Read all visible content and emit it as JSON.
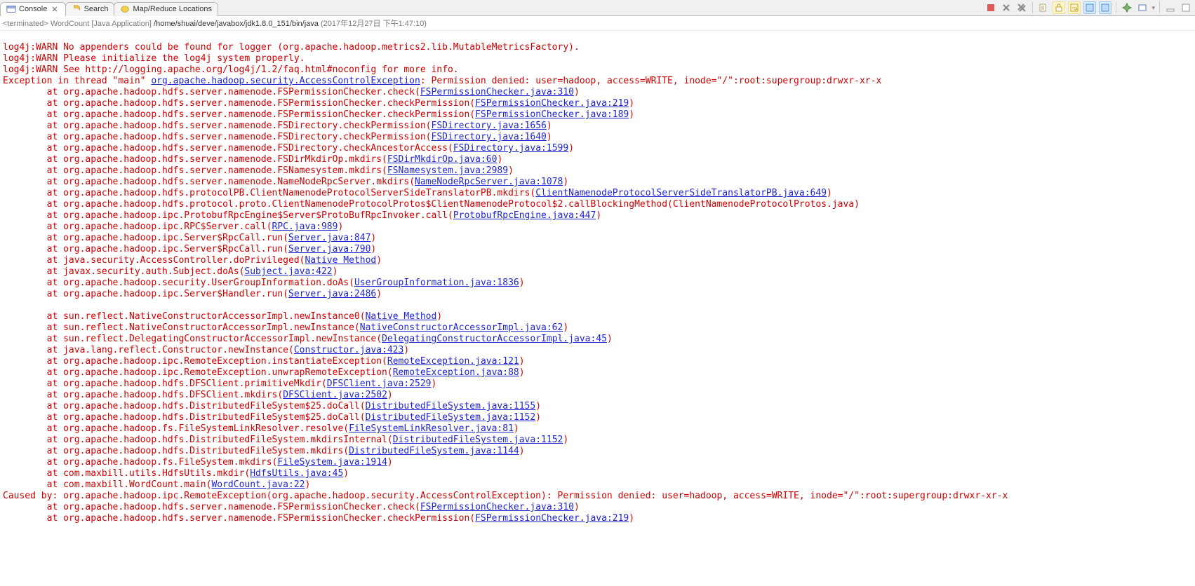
{
  "tabs": {
    "console": "Console",
    "search": "Search",
    "mapreduce": "Map/Reduce Locations"
  },
  "status": {
    "prefix": "<terminated> WordCount [Java Application] ",
    "path": "/home/shuai/deve/javabox/jdk1.8.0_151/bin/java",
    "time": " (2017年12月27日 下午1:47:10)"
  },
  "lines": {
    "l0": "log4j:WARN No appenders could be found for logger (org.apache.hadoop.metrics2.lib.MutableMetricsFactory).",
    "l1": "log4j:WARN Please initialize the log4j system properly.",
    "l2": "log4j:WARN See http://logging.apache.org/log4j/1.2/faq.html#noconfig for more info.",
    "e_pre": "Exception in thread \"main\" ",
    "e_link": "org.apache.hadoop.security.AccessControlException",
    "e_post": ": Permission denied: user=hadoop, access=WRITE, inode=\"/\":root:supergroup:drwxr-xr-x",
    "at": "\tat ",
    "s1a": "org.apache.hadoop.hdfs.server.namenode.FSPermissionChecker.check(",
    "s1b": "FSPermissionChecker.java:310",
    "s2a": "org.apache.hadoop.hdfs.server.namenode.FSPermissionChecker.checkPermission(",
    "s2b": "FSPermissionChecker.java:219",
    "s3a": "org.apache.hadoop.hdfs.server.namenode.FSPermissionChecker.checkPermission(",
    "s3b": "FSPermissionChecker.java:189",
    "s4a": "org.apache.hadoop.hdfs.server.namenode.FSDirectory.checkPermission(",
    "s4b": "FSDirectory.java:1656",
    "s5a": "org.apache.hadoop.hdfs.server.namenode.FSDirectory.checkPermission(",
    "s5b": "FSDirectory.java:1640",
    "s6a": "org.apache.hadoop.hdfs.server.namenode.FSDirectory.checkAncestorAccess(",
    "s6b": "FSDirectory.java:1599",
    "s7a": "org.apache.hadoop.hdfs.server.namenode.FSDirMkdirOp.mkdirs(",
    "s7b": "FSDirMkdirOp.java:60",
    "s8a": "org.apache.hadoop.hdfs.server.namenode.FSNamesystem.mkdirs(",
    "s8b": "FSNamesystem.java:2989",
    "s9a": "org.apache.hadoop.hdfs.server.namenode.NameNodeRpcServer.mkdirs(",
    "s9b": "NameNodeRpcServer.java:1078",
    "s10a": "org.apache.hadoop.hdfs.protocolPB.ClientNamenodeProtocolServerSideTranslatorPB.mkdirs(",
    "s10b": "ClientNamenodeProtocolServerSideTranslatorPB.java:649",
    "s11": "org.apache.hadoop.hdfs.protocol.proto.ClientNamenodeProtocolProtos$ClientNamenodeProtocol$2.callBlockingMethod(ClientNamenodeProtocolProtos.java)",
    "s12a": "org.apache.hadoop.ipc.ProtobufRpcEngine$Server$ProtoBufRpcInvoker.call(",
    "s12b": "ProtobufRpcEngine.java:447",
    "s13a": "org.apache.hadoop.ipc.RPC$Server.call(",
    "s13b": "RPC.java:989",
    "s14a": "org.apache.hadoop.ipc.Server$RpcCall.run(",
    "s14b": "Server.java:847",
    "s15a": "org.apache.hadoop.ipc.Server$RpcCall.run(",
    "s15b": "Server.java:790",
    "s16a": "java.security.AccessController.doPrivileged(",
    "s16b": "Native Method",
    "s17a": "javax.security.auth.Subject.doAs(",
    "s17b": "Subject.java:422",
    "s18a": "org.apache.hadoop.security.UserGroupInformation.doAs(",
    "s18b": "UserGroupInformation.java:1836",
    "s19a": "org.apache.hadoop.ipc.Server$Handler.run(",
    "s19b": "Server.java:2486",
    "s20a": "sun.reflect.NativeConstructorAccessorImpl.newInstance0(",
    "s20b": "Native Method",
    "s21a": "sun.reflect.NativeConstructorAccessorImpl.newInstance(",
    "s21b": "NativeConstructorAccessorImpl.java:62",
    "s22a": "sun.reflect.DelegatingConstructorAccessorImpl.newInstance(",
    "s22b": "DelegatingConstructorAccessorImpl.java:45",
    "s23a": "java.lang.reflect.Constructor.newInstance(",
    "s23b": "Constructor.java:423",
    "s24a": "org.apache.hadoop.ipc.RemoteException.instantiateException(",
    "s24b": "RemoteException.java:121",
    "s25a": "org.apache.hadoop.ipc.RemoteException.unwrapRemoteException(",
    "s25b": "RemoteException.java:88",
    "s26a": "org.apache.hadoop.hdfs.DFSClient.primitiveMkdir(",
    "s26b": "DFSClient.java:2529",
    "s27a": "org.apache.hadoop.hdfs.DFSClient.mkdirs(",
    "s27b": "DFSClient.java:2502",
    "s28a": "org.apache.hadoop.hdfs.DistributedFileSystem$25.doCall(",
    "s28b": "DistributedFileSystem.java:1155",
    "s29a": "org.apache.hadoop.hdfs.DistributedFileSystem$25.doCall(",
    "s29b": "DistributedFileSystem.java:1152",
    "s30a": "org.apache.hadoop.fs.FileSystemLinkResolver.resolve(",
    "s30b": "FileSystemLinkResolver.java:81",
    "s31a": "org.apache.hadoop.hdfs.DistributedFileSystem.mkdirsInternal(",
    "s31b": "DistributedFileSystem.java:1152",
    "s32a": "org.apache.hadoop.hdfs.DistributedFileSystem.mkdirs(",
    "s32b": "DistributedFileSystem.java:1144",
    "s33a": "org.apache.hadoop.fs.FileSystem.mkdirs(",
    "s33b": "FileSystem.java:1914",
    "s34a": "com.maxbill.utils.HdfsUtils.mkdir(",
    "s34b": "HdfsUtils.java:45",
    "s35a": "com.maxbill.WordCount.main(",
    "s35b": "WordCount.java:22",
    "cause": "Caused by: org.apache.hadoop.ipc.RemoteException(org.apache.hadoop.security.AccessControlException): Permission denied: user=hadoop, access=WRITE, inode=\"/\":root:supergroup:drwxr-xr-x",
    "c1a": "org.apache.hadoop.hdfs.server.namenode.FSPermissionChecker.check(",
    "c1b": "FSPermissionChecker.java:310",
    "c2a": "org.apache.hadoop.hdfs.server.namenode.FSPermissionChecker.checkPermission(",
    "c2b": "FSPermissionChecker.java:219",
    "close": ")"
  }
}
